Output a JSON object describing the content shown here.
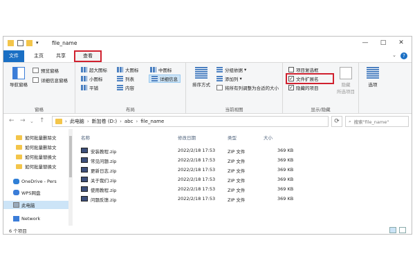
{
  "window": {
    "title": "file_name",
    "controls": [
      "—",
      "□",
      "✕"
    ]
  },
  "tabs": {
    "file": "文件",
    "home": "主页",
    "share": "共享",
    "view": "查看"
  },
  "ribbon": {
    "panes": {
      "label": "窗格",
      "nav_pane": "导航窗格",
      "preview_pane": "预览窗格",
      "details_pane": "详细信息窗格"
    },
    "layout": {
      "label": "布局",
      "items": [
        "超大图标",
        "大图标",
        "中图标",
        "小图标",
        "列表",
        "详细信息",
        "平铺",
        "内容"
      ]
    },
    "current_view": {
      "label": "当前视图",
      "sort_by": "排序方式",
      "group_by": "分组依据",
      "add_column": "添加列",
      "size_all": "将所有列调整为合适的大小"
    },
    "show_hide": {
      "label": "显示/隐藏",
      "item_checkboxes": "项目复选框",
      "file_extensions": "文件扩展名",
      "hidden_items": "隐藏的项目",
      "hide": "隐藏",
      "selected_items": "所选项目",
      "options": "选项"
    }
  },
  "address": {
    "segments": [
      "此电脑",
      "新加卷 (D:)",
      "abc",
      "file_name"
    ],
    "search_placeholder": "搜索\"file_name\""
  },
  "navpane": {
    "items": [
      "如何批量删除文",
      "如何批量删除文",
      "如何批量替换文",
      "如何批量替换文",
      "OneDrive - Pers",
      "WPS网盘",
      "此电脑",
      "Network"
    ]
  },
  "columns": {
    "name": "名称",
    "modified": "修改日期",
    "type": "类型",
    "size": "大小"
  },
  "files": [
    {
      "name": "安装教程.zip",
      "date": "2022/2/18 17:53",
      "type": "ZIP 文件",
      "size": "369 KB"
    },
    {
      "name": "常见问题.zip",
      "date": "2022/2/18 17:53",
      "type": "ZIP 文件",
      "size": "369 KB"
    },
    {
      "name": "更新日志.zip",
      "date": "2022/2/18 17:53",
      "type": "ZIP 文件",
      "size": "369 KB"
    },
    {
      "name": "关于我们.zip",
      "date": "2022/2/18 17:53",
      "type": "ZIP 文件",
      "size": "369 KB"
    },
    {
      "name": "使用教程.zip",
      "date": "2022/2/18 17:53",
      "type": "ZIP 文件",
      "size": "369 KB"
    },
    {
      "name": "问题反馈.zip",
      "date": "2022/2/18 17:53",
      "type": "ZIP 文件",
      "size": "369 KB"
    }
  ],
  "status": {
    "count": "6 个项目"
  },
  "colors": {
    "accent": "#1a6fc4",
    "highlight": "#d0202e"
  }
}
